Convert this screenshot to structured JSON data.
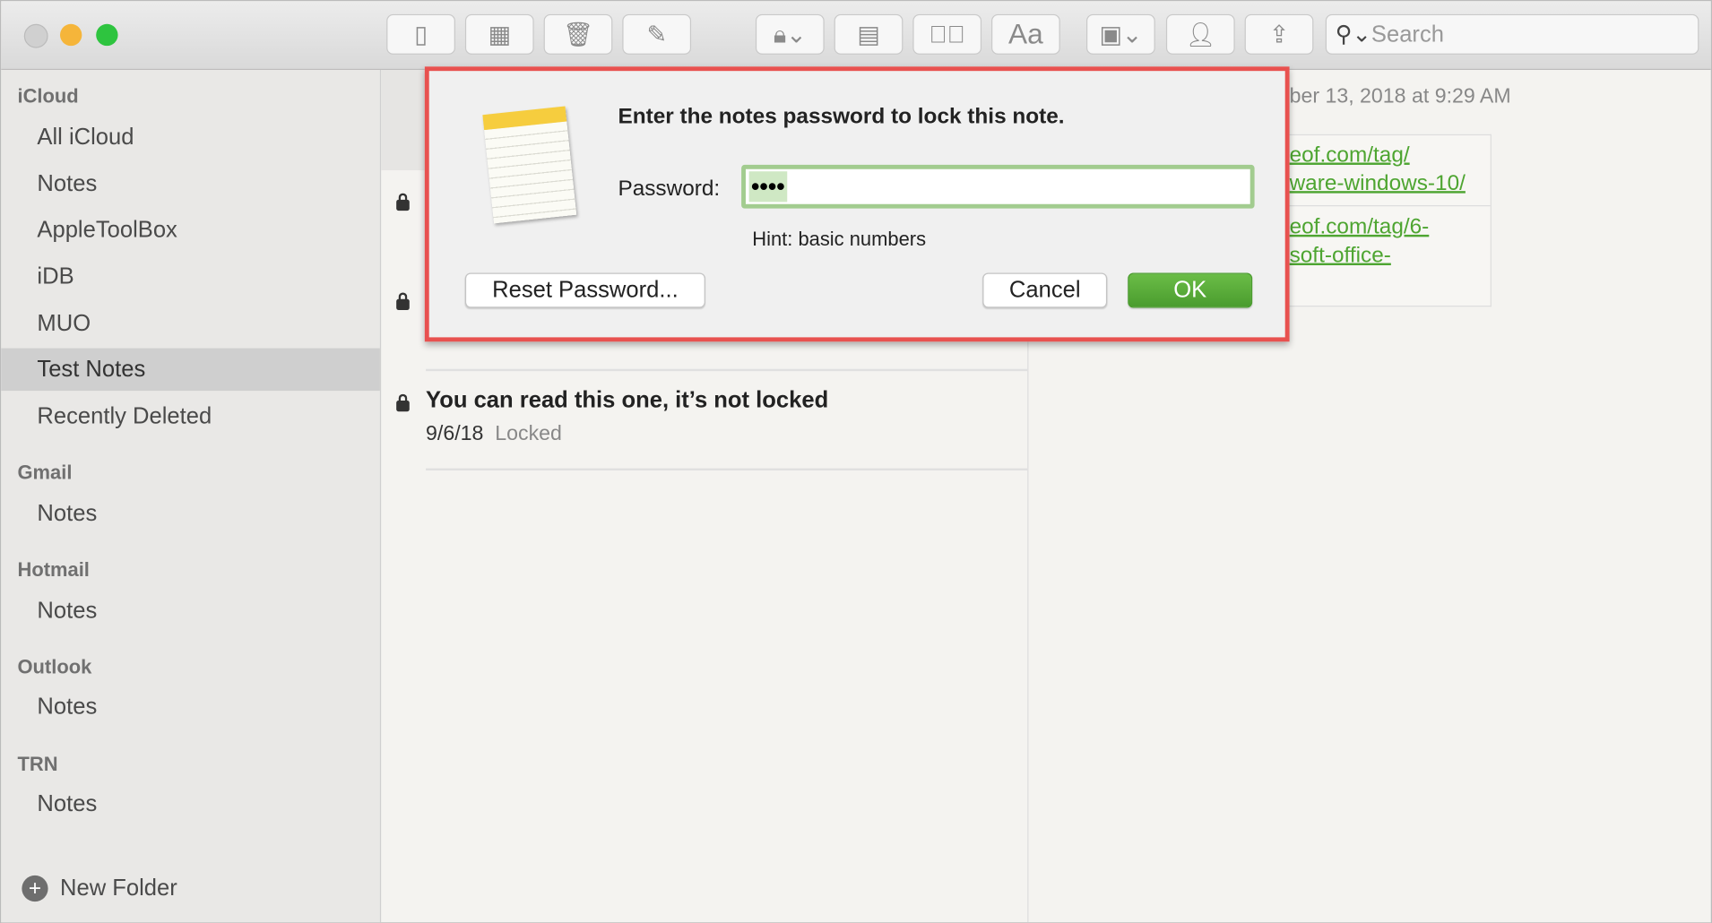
{
  "window": {
    "traffic_lights": {
      "close": "#d0d0d0",
      "minimize": "#f5b53a",
      "zoom": "#2ec43f"
    }
  },
  "toolbar": {
    "search_placeholder": "Search",
    "buttons": [
      "sidebar-icon",
      "gallery-icon",
      "trash-icon",
      "compose-icon",
      "lock-icon",
      "table-icon",
      "checklist-icon",
      "format-icon",
      "media-icon",
      "add-people-icon",
      "share-icon"
    ],
    "format_label": "Aa"
  },
  "sidebar": {
    "sections": [
      {
        "title": "iCloud",
        "items": [
          "All iCloud",
          "Notes",
          "AppleToolBox",
          "iDB",
          "MUO",
          "Test Notes",
          "Recently Deleted"
        ]
      },
      {
        "title": "Gmail",
        "items": [
          "Notes"
        ]
      },
      {
        "title": "Hotmail",
        "items": [
          "Notes"
        ]
      },
      {
        "title": "Outlook",
        "items": [
          "Notes"
        ]
      },
      {
        "title": "TRN",
        "items": [
          "Notes"
        ]
      }
    ],
    "selected": "Test Notes",
    "new_folder": "New Folder"
  },
  "notes_list": [
    {
      "title": "You can read this one, it’s not locked",
      "date": "9/6/18",
      "status": "Locked"
    }
  ],
  "note": {
    "date": "ber 13, 2018 at 9:29 AM",
    "links": [
      "eof.com/tag/",
      "ware-windows-10/",
      "eof.com/tag/6-",
      "soft-office-"
    ]
  },
  "dialog": {
    "title": "Enter the notes password to lock this note.",
    "password_label": "Password:",
    "password_value": "••••",
    "hint": "Hint: basic numbers",
    "reset_button": "Reset Password...",
    "cancel_button": "Cancel",
    "ok_button": "OK",
    "accent": "#56a93a",
    "highlight": "#e8514f"
  }
}
